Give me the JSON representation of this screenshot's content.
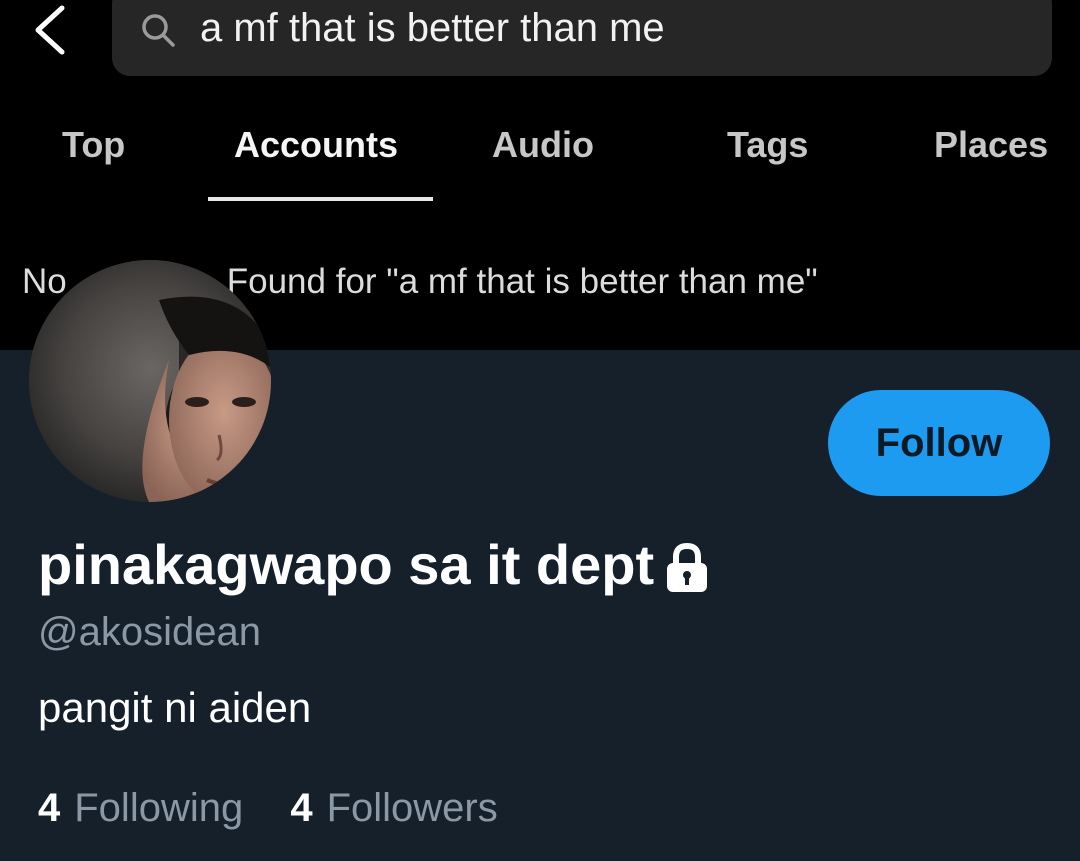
{
  "search": {
    "query": "a mf that is better than me"
  },
  "tabs": [
    {
      "label": "Top"
    },
    {
      "label": "Accounts"
    },
    {
      "label": "Audio"
    },
    {
      "label": "Tags"
    },
    {
      "label": "Places"
    }
  ],
  "active_tab": "Accounts",
  "no_result": {
    "prefix": "No",
    "suffix": "Found for \"a mf that is better than me\""
  },
  "profile": {
    "display_name": "pinakagwapo sa it dept",
    "handle": "@akosidean",
    "bio": "pangit ni aiden",
    "follow_label": "Follow",
    "following_count": "4",
    "following_label": "Following",
    "followers_count": "4",
    "followers_label": "Followers",
    "protected_icon": "lock-icon"
  },
  "colors": {
    "panel_bg": "#15202b",
    "accent": "#1d9bf0",
    "muted_text": "#8b98a5"
  }
}
